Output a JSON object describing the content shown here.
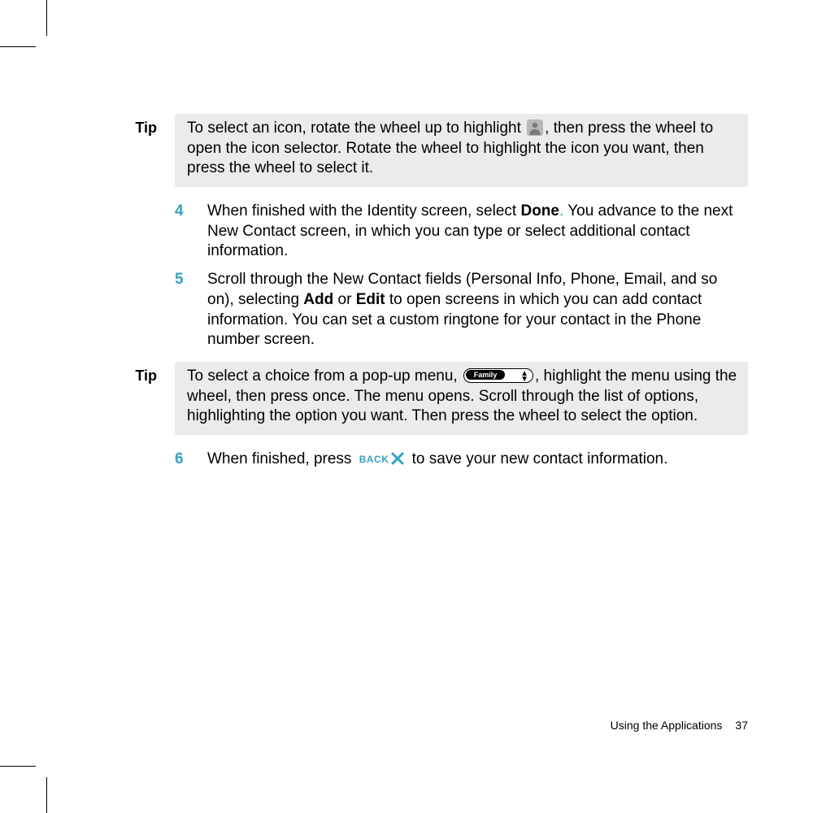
{
  "tips": {
    "tip1_label": "Tip",
    "tip1_before": "To select an icon, rotate the wheel up to highlight ",
    "tip1_after": ", then press the wheel to open the icon selector. Rotate the wheel to highlight the icon you want, then press the wheel to select it.",
    "tip2_label": "Tip",
    "tip2_before": "To select a choice from a pop-up menu, ",
    "tip2_after": ", highlight the menu using the wheel, then press once. The menu opens. Scroll through the list of options, highlighting the option you want. Then press the wheel to select the option.",
    "popup_label": "Family"
  },
  "steps": {
    "s4_num": "4",
    "s4_a": "When finished with the Identity screen, select ",
    "s4_done": "Done",
    "s4_dot": ".",
    "s4_b": " You advance to the next New Contact screen, in which you can type or select additional contact information.",
    "s5_num": "5",
    "s5_a": "Scroll through the New Contact fields (Personal Info, Phone, Email, and so on), selecting ",
    "s5_add": "Add",
    "s5_or": " or ",
    "s5_edit": "Edit",
    "s5_b": " to open screens in which you can add contact information. You can set a custom ringtone for your contact in the Phone number screen.",
    "s6_num": "6",
    "s6_a": "When finished, press ",
    "s6_back": "BACK",
    "s6_b": " to save your new contact information."
  },
  "footer": {
    "section": "Using the Applications",
    "page": "37"
  }
}
